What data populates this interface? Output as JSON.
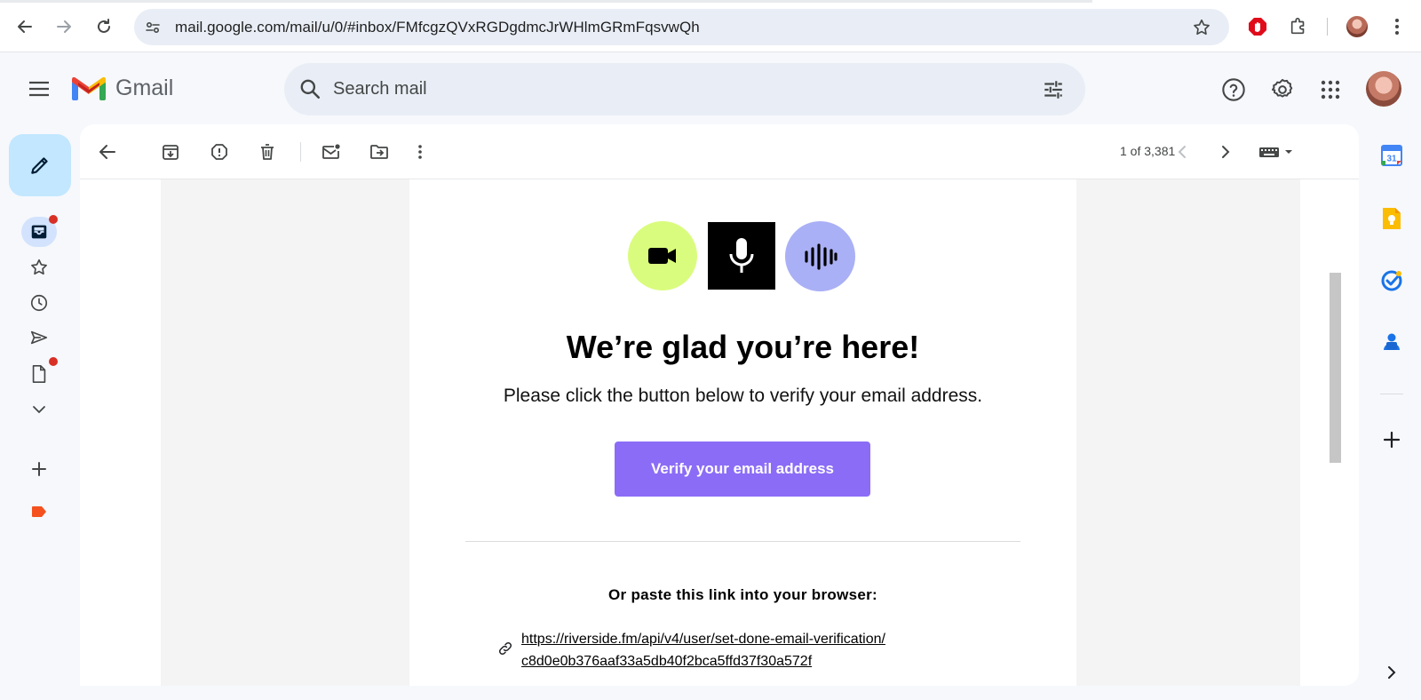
{
  "browser": {
    "url": "mail.google.com/mail/u/0/#inbox/FMfcgzQVxRGDgdmcJrWHlmGRmFqsvwQh"
  },
  "gmail": {
    "logo_text": "Gmail",
    "search_placeholder": "Search mail"
  },
  "toolbar": {
    "pager": "1 of 3,381"
  },
  "email": {
    "heading": "We’re glad you’re here!",
    "subtext": "Please click the button below to verify your email address.",
    "button_label": "Verify your email address",
    "paste_label": "Or paste this link into your browser:",
    "link_line1": "https://riverside.fm/api/v4/user/set-done-email-verification/",
    "link_line2": "c8d0e0b376aaf33a5db40f2bca5ffd37f30a572f",
    "colors": {
      "button": "#8b6cf6",
      "video_circle": "#dafc7e",
      "audio_circle": "#aab0f5"
    }
  },
  "side_panel": {
    "calendar_day": "31"
  },
  "icons": [
    "back-icon",
    "forward-icon",
    "reload-icon",
    "site-info-icon",
    "bookmark-star-icon",
    "adblock-icon",
    "extensions-icon",
    "profile-avatar",
    "menu-icon",
    "gmail-logo",
    "search-icon",
    "search-options-icon",
    "help-icon",
    "settings-icon",
    "apps-icon",
    "compose-icon",
    "inbox-icon",
    "starred-icon",
    "snoozed-icon",
    "sent-icon",
    "drafts-icon",
    "more-icon",
    "add-label-icon",
    "label-icon",
    "archive-icon",
    "report-spam-icon",
    "delete-icon",
    "mark-unread-icon",
    "move-to-icon",
    "more-vert-icon",
    "keyboard-icon",
    "calendar-icon",
    "keep-icon",
    "tasks-icon",
    "contacts-icon",
    "plus-icon",
    "chevron-right-icon"
  ]
}
